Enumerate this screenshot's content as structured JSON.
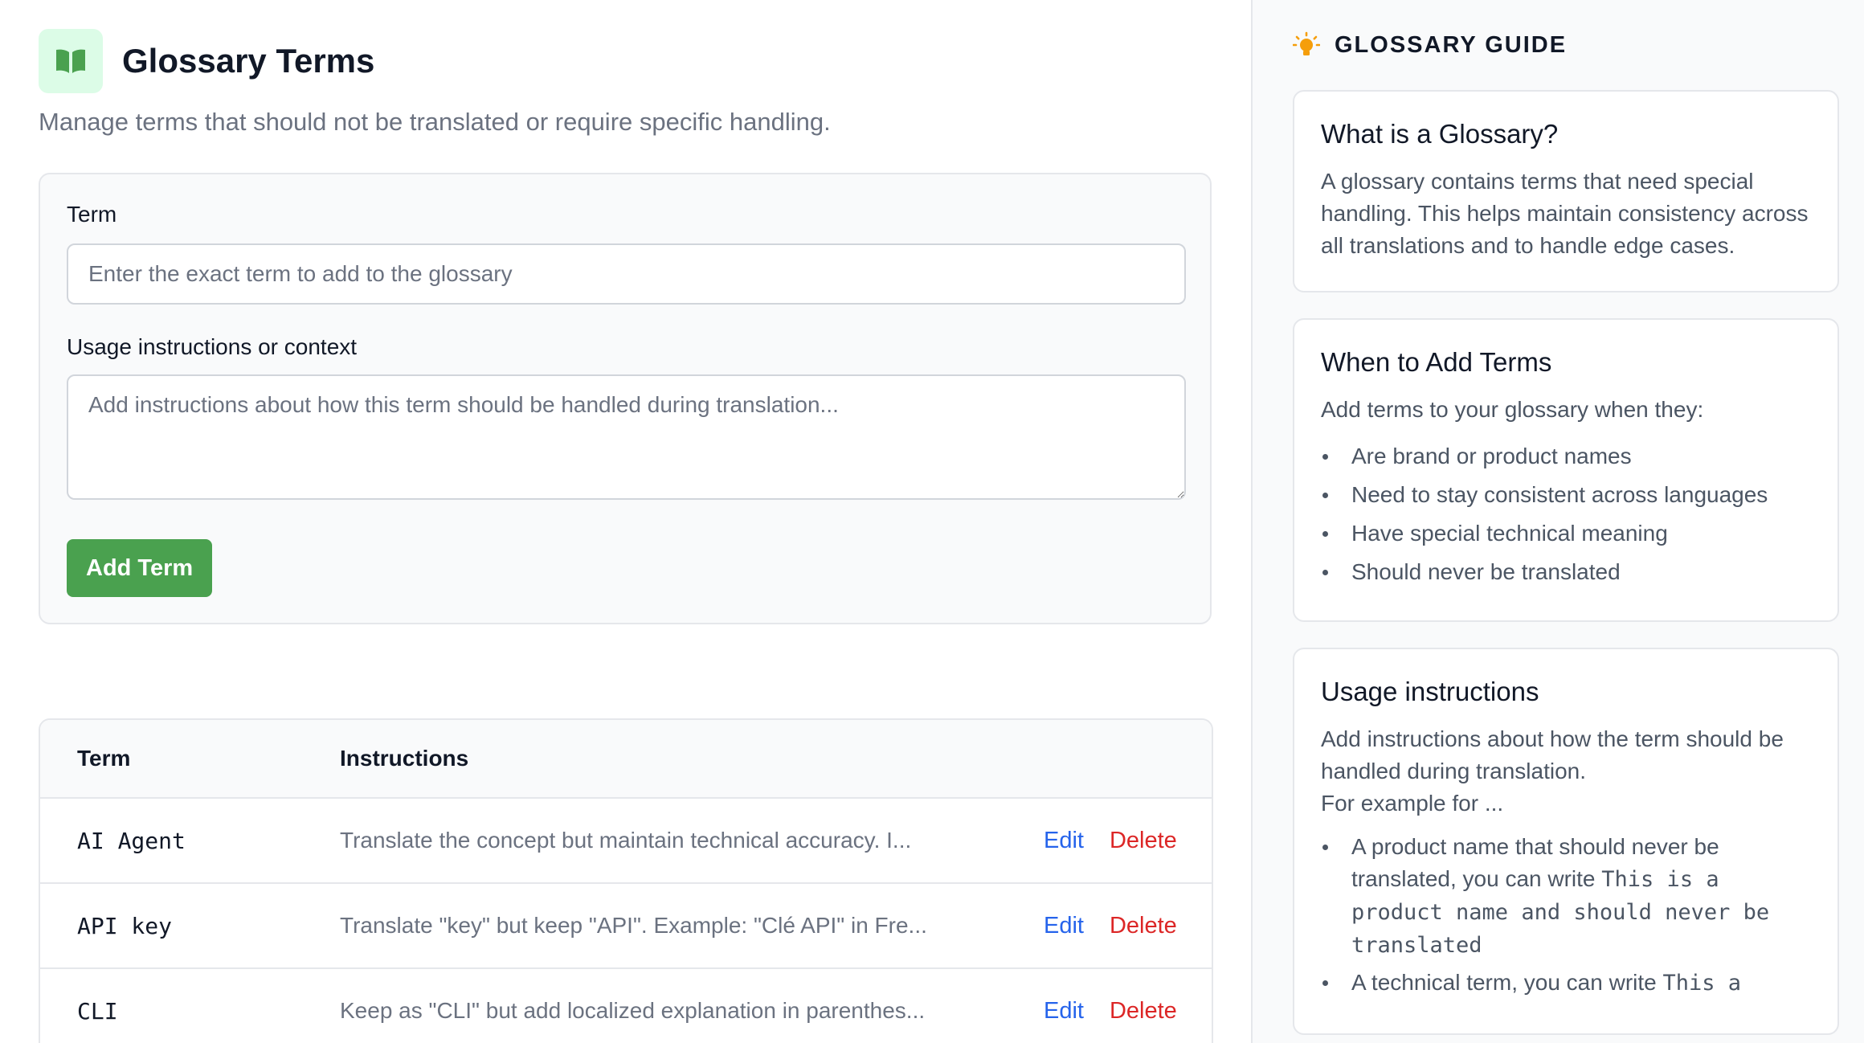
{
  "header": {
    "title": "Glossary Terms",
    "subtitle": "Manage terms that should not be translated or require specific handling."
  },
  "form": {
    "term_label": "Term",
    "term_placeholder": "Enter the exact term to add to the glossary",
    "instructions_label": "Usage instructions or context",
    "instructions_placeholder": "Add instructions about how this term should be handled during translation...",
    "submit_label": "Add Term"
  },
  "table": {
    "headers": {
      "term": "Term",
      "instructions": "Instructions"
    },
    "rows": [
      {
        "term": "AI Agent",
        "instructions": "Translate the concept but maintain technical accuracy. I...",
        "edit": "Edit",
        "delete": "Delete"
      },
      {
        "term": "API key",
        "instructions": "Translate \"key\" but keep \"API\". Example: \"Clé API\" in Fre...",
        "edit": "Edit",
        "delete": "Delete"
      },
      {
        "term": "CLI",
        "instructions": "Keep as \"CLI\" but add localized explanation in parenthes...",
        "edit": "Edit",
        "delete": "Delete"
      }
    ]
  },
  "guide": {
    "title": "GLOSSARY GUIDE",
    "cards": [
      {
        "title": "What is a Glossary?",
        "text": "A glossary contains terms that need special handling. This helps maintain consistency across all translations and to handle edge cases."
      },
      {
        "title": "When to Add Terms",
        "text": "Add terms to your glossary when they:",
        "bullets": [
          "Are brand or product names",
          "Need to stay consistent across languages",
          "Have special technical meaning",
          "Should never be translated"
        ]
      },
      {
        "title": "Usage instructions",
        "text_line1": "Add instructions about how the term should be handled during translation.",
        "text_line2": "For example for ...",
        "example1_prefix": "A product name that should never be translated, you can write ",
        "example1_code": "This is a product name and should never be translated",
        "example2_prefix": "A technical term, you can write ",
        "example2_code": "This a"
      }
    ]
  },
  "colors": {
    "accent_green": "#4aa14f",
    "link_blue": "#2563eb",
    "danger_red": "#dc2626",
    "logo_bg": "#dcfce7",
    "bulb": "#f59e0b"
  },
  "icons": {
    "logo": "open-book-icon",
    "guide": "lightbulb-icon"
  }
}
